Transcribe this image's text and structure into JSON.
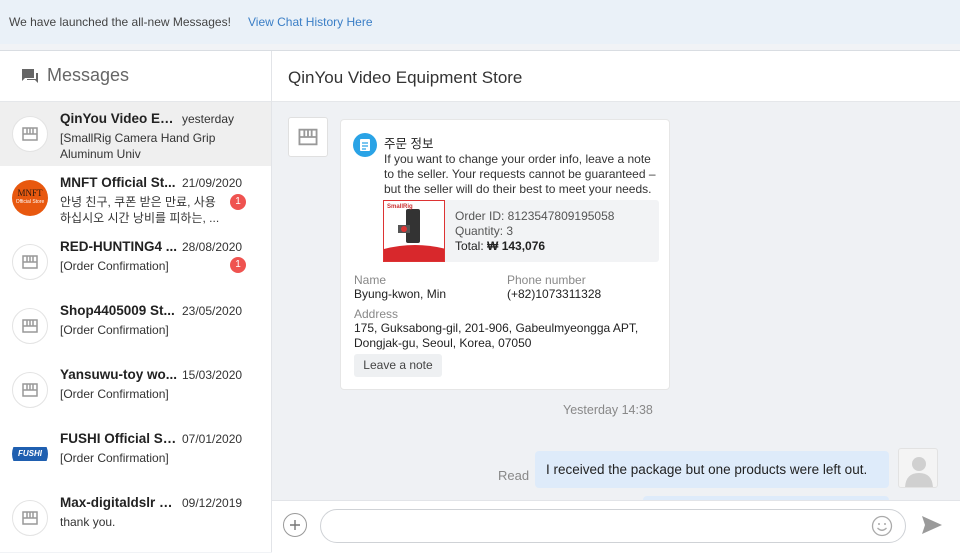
{
  "banner": {
    "message": "We have launched the all-new Messages!",
    "link": "View Chat History Here"
  },
  "sidebar": {
    "title": "Messages",
    "conversations": [
      {
        "name": "QinYou Video Equi...",
        "date": "yesterday",
        "preview": "[SmallRig Camera Hand Grip Aluminum Univ",
        "badge": "",
        "avatar": "store-icon",
        "active": true
      },
      {
        "name": "MNFT Official St...",
        "date": "21/09/2020",
        "preview": "안녕 친구, 쿠폰 받은 만료, 사용하십시오 시간 낭비를 피하는, ...",
        "badge": "1",
        "avatar": "mnft-logo"
      },
      {
        "name": "RED-HUNTING4 ...",
        "date": "28/08/2020",
        "preview": "[Order Confirmation]",
        "badge": "1",
        "avatar": "store-icon"
      },
      {
        "name": "Shop4405009 St...",
        "date": "23/05/2020",
        "preview": "[Order Confirmation]",
        "badge": "",
        "avatar": "store-icon"
      },
      {
        "name": "Yansuwu-toy wo...",
        "date": "15/03/2020",
        "preview": "[Order Confirmation]",
        "badge": "",
        "avatar": "store-icon"
      },
      {
        "name": "FUSHI Official St...",
        "date": "07/01/2020",
        "preview": "[Order Confirmation]",
        "badge": "",
        "avatar": "fushi-logo"
      },
      {
        "name": "Max-digitaldslr S...",
        "date": "09/12/2019",
        "preview": "thank you.",
        "badge": "",
        "avatar": "store-icon"
      }
    ],
    "logos": {
      "mnft": "MNFT",
      "mnft_sub": "Official Store",
      "fushi": "FUSHI"
    }
  },
  "main": {
    "title": "QinYou Video Equipment Store",
    "order_card": {
      "title": "주문 정보",
      "description": "If you want to change your order info, leave a note to the seller. Your requests cannot be guaranteed – but the seller will do their best to meet your needs.",
      "product_brand": "SmallRig",
      "order_id": "Order ID: 8123547809195058",
      "quantity": "Quantity: 3",
      "total_label": "Total:",
      "total_value": "₩ 143,076",
      "name_label": "Name",
      "name_value": "Byung-kwon, Min",
      "phone_label": "Phone number",
      "phone_value": "(+82)1073311328",
      "address_label": "Address",
      "address_value": "175, Guksabong-gil, 201-906, Gabeulmyeongga APT, Dongjak-gu, Seoul, Korea, 07050",
      "note_button": "Leave a note"
    },
    "timestamp": "Yesterday 14:38",
    "read_label": "Read",
    "sent_message": "I received the package but one products were left out.",
    "composer": {
      "placeholder": ""
    }
  },
  "colors": {
    "accent": "#3a7ec6",
    "badge": "#ef5350",
    "bubble": "#deebfa",
    "doc_icon": "#2aa3e6"
  }
}
